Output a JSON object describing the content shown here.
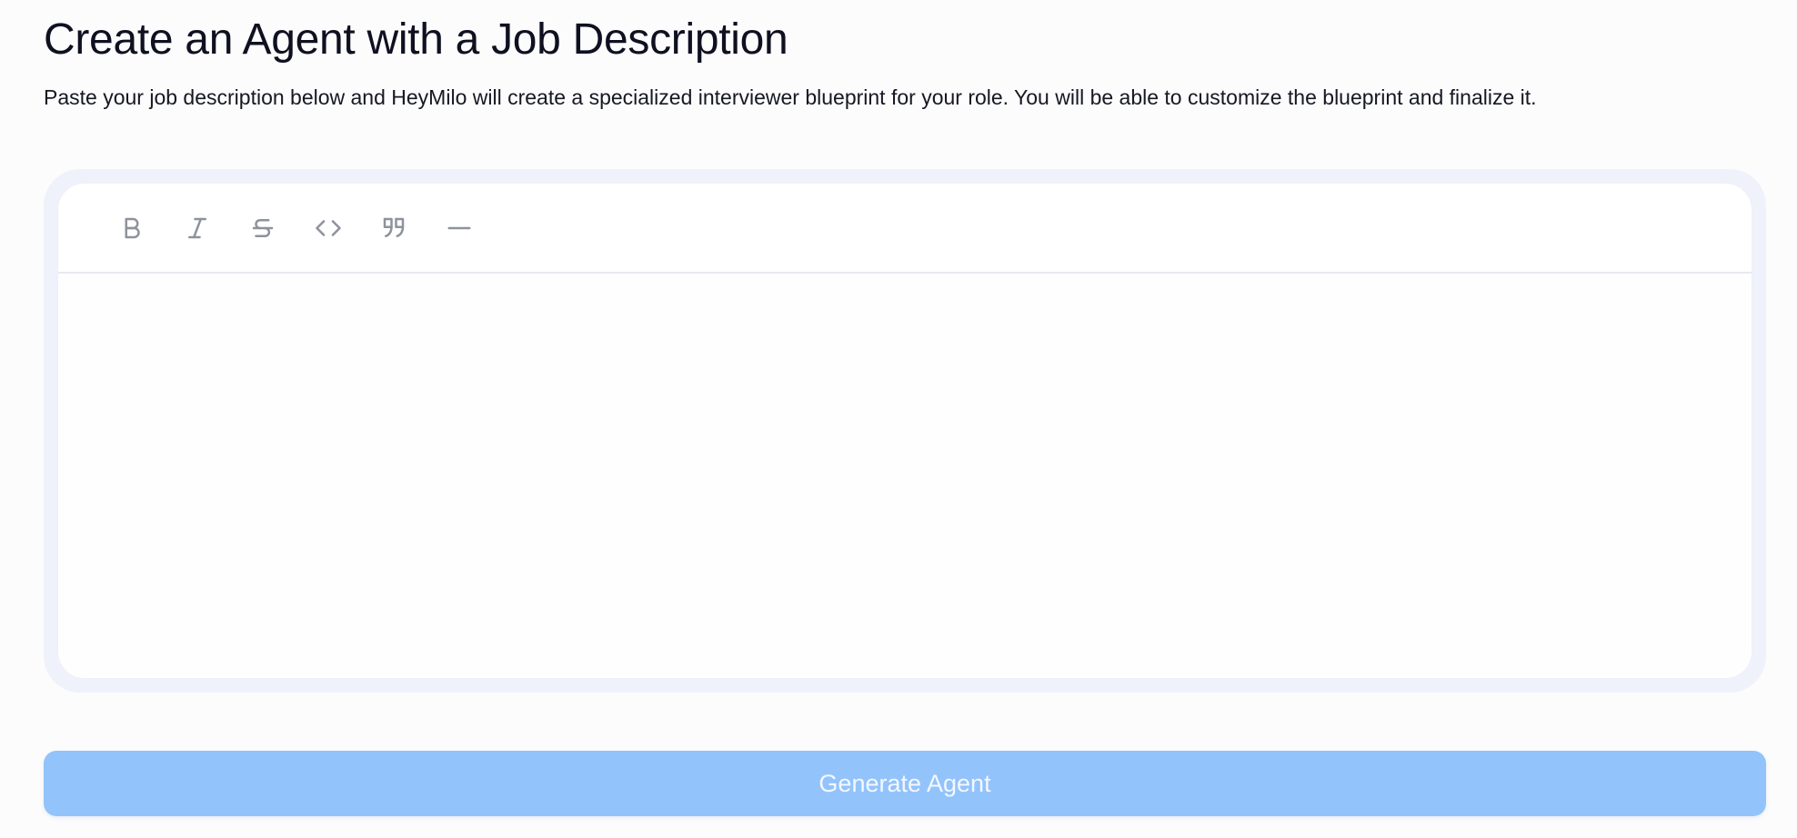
{
  "header": {
    "title": "Create an Agent with a Job Description",
    "description": "Paste your job description below and HeyMilo will create a specialized interviewer blueprint for your role. You will be able to customize the blueprint and finalize it."
  },
  "editor": {
    "toolbar": [
      {
        "name": "bold",
        "icon": "bold-icon"
      },
      {
        "name": "italic",
        "icon": "italic-icon"
      },
      {
        "name": "strikethrough",
        "icon": "strikethrough-icon"
      },
      {
        "name": "code",
        "icon": "code-icon"
      },
      {
        "name": "blockquote",
        "icon": "quote-icon"
      },
      {
        "name": "horizontal-rule",
        "icon": "horizontal-rule-icon"
      }
    ],
    "content": ""
  },
  "actions": {
    "generate_label": "Generate Agent"
  },
  "colors": {
    "button_bg": "#93c3fb",
    "button_text": "#f3f8ff",
    "editor_frame": "#f0f2fb",
    "toolbar_icon": "#8e929c"
  }
}
